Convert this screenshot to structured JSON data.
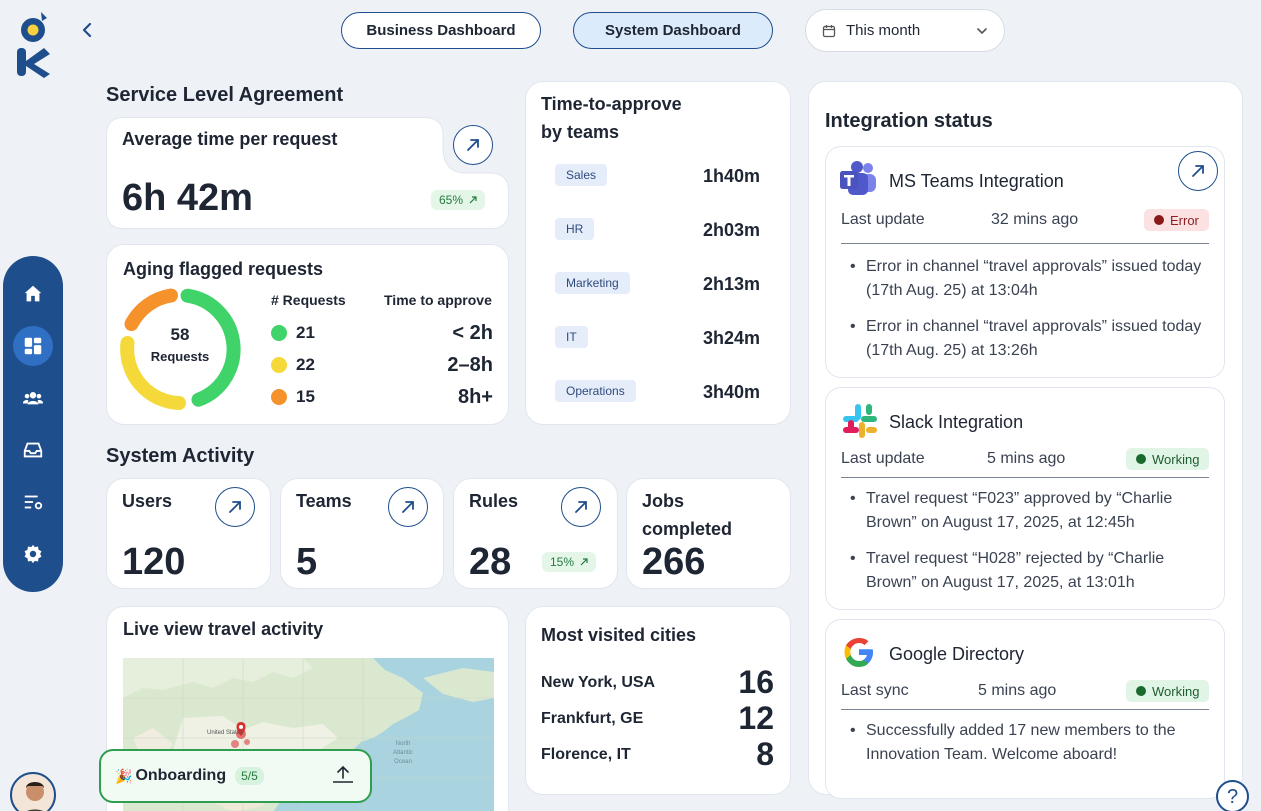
{
  "header": {
    "back_icon": "chevron-left-icon",
    "tabs": [
      {
        "label": "Business Dashboard",
        "active": false
      },
      {
        "label": "System Dashboard",
        "active": true
      }
    ],
    "period": {
      "label": "This month",
      "icon": "calendar-icon"
    }
  },
  "sidebar": {
    "items": [
      {
        "name": "home",
        "icon": "home-icon",
        "active": false
      },
      {
        "name": "dashboard",
        "icon": "dashboard-icon",
        "active": true
      },
      {
        "name": "users",
        "icon": "users-icon",
        "active": false
      },
      {
        "name": "inbox",
        "icon": "inbox-icon",
        "active": false
      },
      {
        "name": "rules",
        "icon": "rules-settings-icon",
        "active": false
      },
      {
        "name": "settings",
        "icon": "gear-icon",
        "active": false
      }
    ]
  },
  "sla": {
    "title": "Service Level Agreement",
    "avg": {
      "label": "Average time per request",
      "value": "6h 42m",
      "badge": "65%"
    },
    "aging": {
      "title": "Aging flagged requests",
      "donut_total": "58",
      "donut_label": "Requests",
      "col_requests": "# Requests",
      "col_time": "Time to approve",
      "rows": [
        {
          "count": "21",
          "time": "< 2h",
          "color": "#3fd36a"
        },
        {
          "count": "22",
          "time": "2–8h",
          "color": "#f5d93a"
        },
        {
          "count": "15",
          "time": "8h+",
          "color": "#f5922b"
        }
      ]
    }
  },
  "approve": {
    "title_line1": "Time-to-approve",
    "title_line2": "by teams",
    "teams": [
      {
        "name": "Sales",
        "time": "1h40m"
      },
      {
        "name": "HR",
        "time": "2h03m"
      },
      {
        "name": "Marketing",
        "time": "2h13m"
      },
      {
        "name": "IT",
        "time": "3h24m"
      },
      {
        "name": "Operations",
        "time": "3h40m"
      }
    ]
  },
  "activity": {
    "title": "System Activity",
    "users": {
      "label": "Users",
      "value": "120"
    },
    "teams": {
      "label": "Teams",
      "value": "5"
    },
    "rules": {
      "label": "Rules",
      "value": "28",
      "badge": "15%"
    },
    "jobs": {
      "label_line1": "Jobs",
      "label_line2": "completed",
      "value": "266"
    }
  },
  "live": {
    "title": "Live view travel activity",
    "map_label_us": "United States",
    "map_label_ocean": "North Atlantic Ocean"
  },
  "cities": {
    "title": "Most visited cities",
    "rows": [
      {
        "name": "New York, USA",
        "count": "16"
      },
      {
        "name": "Frankfurt, GE",
        "count": "12"
      },
      {
        "name": "Florence, IT",
        "count": "8"
      }
    ]
  },
  "onboarding": {
    "label": "Onboarding",
    "progress": "5/5",
    "emoji": "🎉"
  },
  "integration": {
    "title": "Integration status",
    "cards": [
      {
        "name": "MS Teams Integration",
        "meta": "Last update",
        "ago": "32 mins ago",
        "status": "Error",
        "bullets": [
          "Error in channel “travel approvals” issued today (17th Aug. 25) at 13:04h",
          "Error in channel “travel approvals” issued today (17th Aug. 25) at 13:26h"
        ]
      },
      {
        "name": "Slack Integration",
        "meta": "Last update",
        "ago": "5 mins ago",
        "status": "Working",
        "bullets": [
          "Travel request “F023” approved by “Charlie Brown” on August 17, 2025, at 12:45h",
          "Travel request “H028” rejected by “Charlie Brown” on August 17, 2025, at 13:01h"
        ]
      },
      {
        "name": "Google Directory",
        "meta": "Last sync",
        "ago": "5 mins ago",
        "status": "Working",
        "bullets": [
          "Successfully added 17 new members to the Innovation Team. Welcome aboard!"
        ]
      }
    ]
  },
  "help": {
    "label": "?"
  }
}
